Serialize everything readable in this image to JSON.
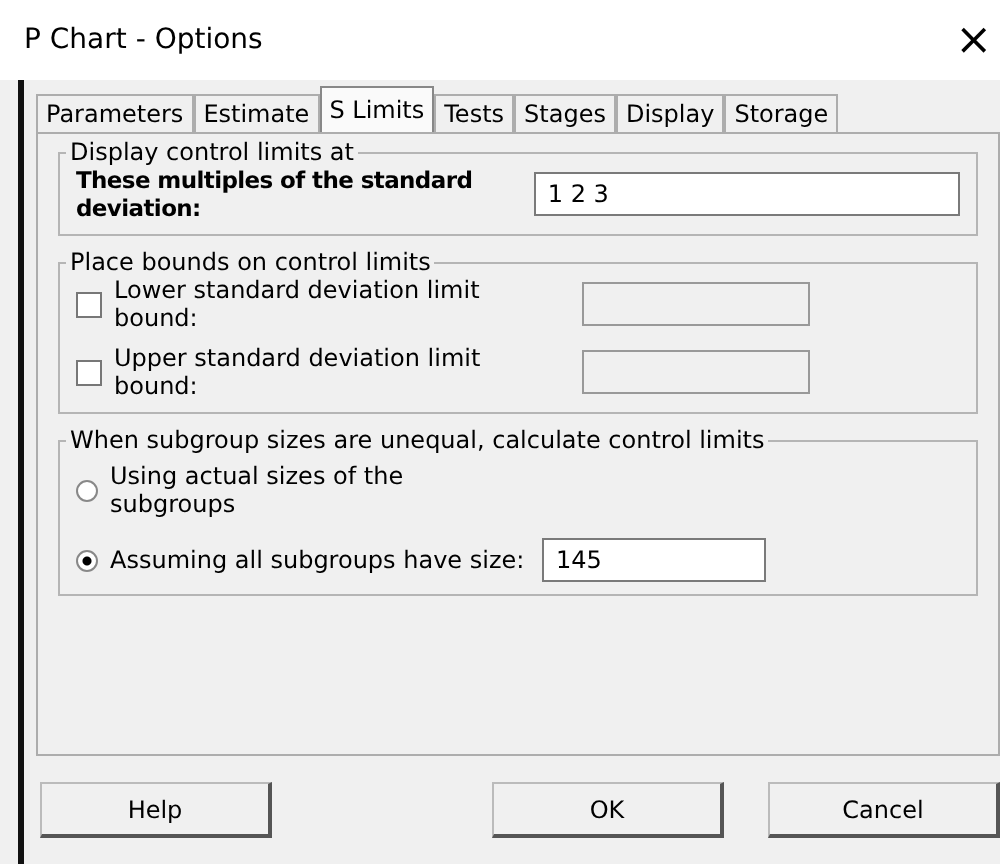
{
  "window": {
    "title": "P Chart - Options",
    "close": "×"
  },
  "tabs": [
    {
      "label": "Parameters",
      "selected": false
    },
    {
      "label": "Estimate",
      "selected": false
    },
    {
      "label": "S Limits",
      "selected": true
    },
    {
      "label": "Tests",
      "selected": false
    },
    {
      "label": "Stages",
      "selected": false
    },
    {
      "label": "Display",
      "selected": false
    },
    {
      "label": "Storage",
      "selected": false
    }
  ],
  "display_group": {
    "title": "Display control limits at",
    "label": "These multiples of the standard deviation:",
    "value": "1 2 3"
  },
  "bounds_group": {
    "title": "Place bounds on control limits",
    "rows": [
      {
        "label": "Lower standard deviation limit bound:",
        "checked": false
      },
      {
        "label": "Upper standard deviation limit bound:",
        "checked": false
      }
    ]
  },
  "subgroup_group": {
    "title": "When subgroup sizes are unequal, calculate control limits",
    "options": [
      {
        "label": "Using actual sizes of the subgroups",
        "selected": false
      },
      {
        "label": "Assuming all subgroups have size:",
        "selected": true,
        "value": "145"
      }
    ]
  },
  "buttons": [
    "Help",
    "OK",
    "Cancel"
  ]
}
